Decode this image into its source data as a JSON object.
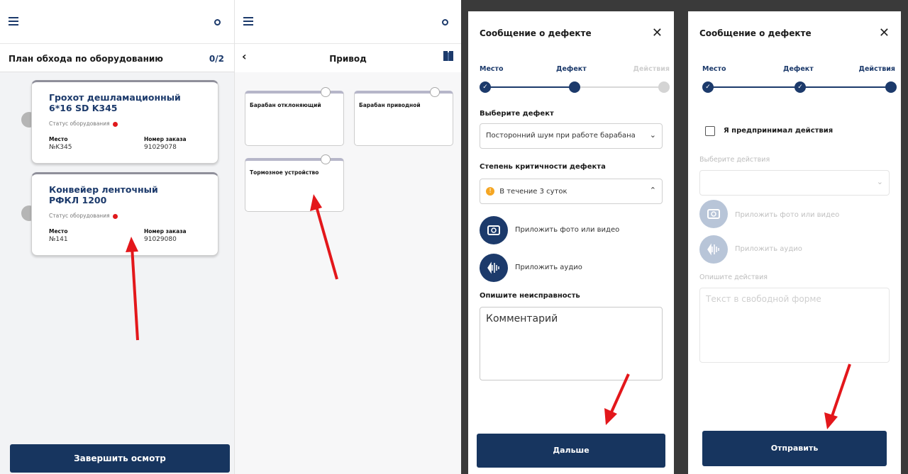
{
  "panel1": {
    "subhead_title": "План обхода по оборудованию",
    "counter": "0/2",
    "cards": [
      {
        "title": "Грохот дешламационный 6*16 SD K345",
        "status_label": "Статус оборудования",
        "place_label": "Место",
        "place_value": "№K345",
        "order_label": "Номер заказа",
        "order_value": "91029078"
      },
      {
        "title": "Конвейер ленточный РФКЛ 1200",
        "status_label": "Статус оборудования",
        "place_label": "Место",
        "place_value": "№141",
        "order_label": "Номер заказа",
        "order_value": "91029080"
      }
    ],
    "finish_button": "Завершить осмотр"
  },
  "panel2": {
    "title": "Привод",
    "items": [
      "Барабан отклоняющий",
      "Барабан приводной",
      "Тормозное устройство"
    ]
  },
  "panel3": {
    "title": "Сообщение о дефекте",
    "close": "✕",
    "steps": [
      "Место",
      "Дефект",
      "Действия"
    ],
    "select_defect_label": "Выберите дефект",
    "select_defect_value": "Посторонний шум при работе барабана",
    "criticality_label": "Степень критичности дефекта",
    "criticality_value": "В течение 3 суток",
    "attach_photo": "Приложить фото или видео",
    "attach_audio": "Приложить аудио",
    "describe_label": "Опишите неисправность",
    "comment_value": "Комментарий",
    "next_button": "Дальше"
  },
  "panel4": {
    "title": "Сообщение о дефекте",
    "close": "✕",
    "steps": [
      "Место",
      "Дефект",
      "Действия"
    ],
    "checkbox_label": "Я предпринимал действия",
    "select_actions_label": "Выберите действия",
    "attach_photo": "Приложить фото или видео",
    "attach_audio": "Приложить аудио",
    "describe_label": "Опишите действия",
    "text_placeholder": "Текст в свободной форме",
    "send_button": "Отправить"
  },
  "colors": {
    "primary": "#1c3a6b",
    "button": "#17355f",
    "status_red": "#e0191c",
    "arrow_red": "#e3171b",
    "warning": "#f5a623"
  },
  "icons": [
    "hamburger-icon",
    "sync-icon",
    "back-chevron-icon",
    "book-icon",
    "close-icon",
    "check-icon",
    "camera-icon",
    "audio-icon",
    "chevron-down-icon",
    "chevron-up-icon",
    "warning-icon"
  ]
}
